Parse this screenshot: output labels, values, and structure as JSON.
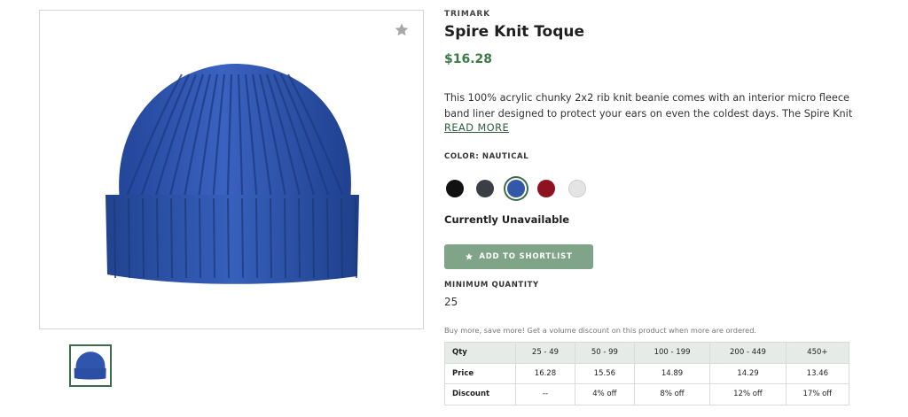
{
  "product": {
    "brand": "TRIMARK",
    "title": "Spire Knit Toque",
    "price": "$16.28",
    "description_lines": [
      "This 100% acrylic chunky 2x2 rib knit beanie comes with an interior micro fleece",
      "band liner designed to protect your ears on even the coldest days. The Spire Knit..."
    ],
    "read_more": "READ MORE",
    "color_label": "COLOR: NAUTICAL",
    "swatches": [
      {
        "name": "black",
        "color": "#111111"
      },
      {
        "name": "charcoal",
        "color": "#3b3e45"
      },
      {
        "name": "nautical",
        "color": "#3358a8"
      },
      {
        "name": "red",
        "color": "#8e1220"
      },
      {
        "name": "light-grey",
        "color": "#e4e4e4"
      }
    ],
    "selected_color": "nautical",
    "availability": "Currently Unavailable",
    "shortlist_button": "ADD TO SHORTLIST",
    "min_qty_label": "MINIMUM QUANTITY",
    "min_qty_value": "25",
    "volume_note": "Buy more, save more! Get a volume discount on this product when more are ordered."
  },
  "pricing": {
    "headers": [
      "Qty",
      "25 - 49",
      "50 - 99",
      "100 - 199",
      "200 - 449",
      "450+"
    ],
    "rows": [
      [
        "Price",
        "16.28",
        "15.56",
        "14.89",
        "14.29",
        "13.46"
      ],
      [
        "Discount",
        "--",
        "4% off",
        "8% off",
        "12% off",
        "17% off"
      ]
    ]
  },
  "icons": {
    "favorite": "star-icon",
    "shortlist": "star-icon"
  },
  "colors": {
    "accent_green": "#3d7a45",
    "button_bg": "#7fa488",
    "table_header_bg": "#e7ebe7"
  }
}
